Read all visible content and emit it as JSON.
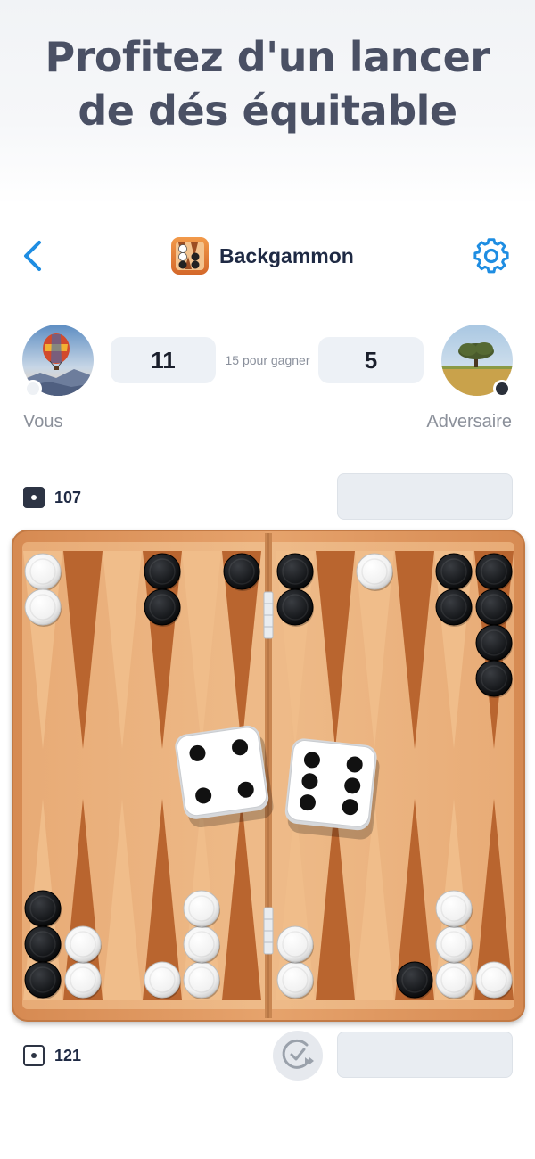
{
  "headline": {
    "line1": "Profitez d'un lancer",
    "line2": "de dés équitable"
  },
  "nav": {
    "title": "Backgammon",
    "back_icon": "chevron-left-icon",
    "settings_icon": "gear-icon"
  },
  "players": {
    "you": {
      "label": "Vous",
      "score": "11",
      "color": "white"
    },
    "opponent": {
      "label": "Adversaire",
      "score": "5",
      "color": "black"
    },
    "target_text": "15 pour gagner"
  },
  "pip_counts": {
    "opponent": "107",
    "you": "121"
  },
  "dice": [
    4,
    6
  ],
  "colors": {
    "accent": "#1e8de2",
    "board": "#e3a06a",
    "point_dark": "#b9652f",
    "checker_black": "#17191d",
    "checker_white": "#f7f7f7"
  },
  "board": {
    "top_points": [
      {
        "color": "white",
        "count": 2
      },
      {
        "color": "",
        "count": 0
      },
      {
        "color": "",
        "count": 0
      },
      {
        "color": "black",
        "count": 2
      },
      {
        "color": "",
        "count": 0
      },
      {
        "color": "black",
        "count": 1
      },
      {
        "color": "black",
        "count": 2
      },
      {
        "color": "",
        "count": 0
      },
      {
        "color": "white",
        "count": 1
      },
      {
        "color": "",
        "count": 0
      },
      {
        "color": "black",
        "count": 2
      },
      {
        "color": "black",
        "count": 4
      }
    ],
    "bottom_points": [
      {
        "color": "black",
        "count": 3
      },
      {
        "color": "white",
        "count": 2
      },
      {
        "color": "",
        "count": 0
      },
      {
        "color": "white",
        "count": 1
      },
      {
        "color": "white",
        "count": 3
      },
      {
        "color": "",
        "count": 0
      },
      {
        "color": "white",
        "count": 2
      },
      {
        "color": "",
        "count": 0
      },
      {
        "color": "",
        "count": 0
      },
      {
        "color": "black",
        "count": 1
      },
      {
        "color": "white",
        "count": 3
      },
      {
        "color": "white",
        "count": 1
      }
    ]
  }
}
